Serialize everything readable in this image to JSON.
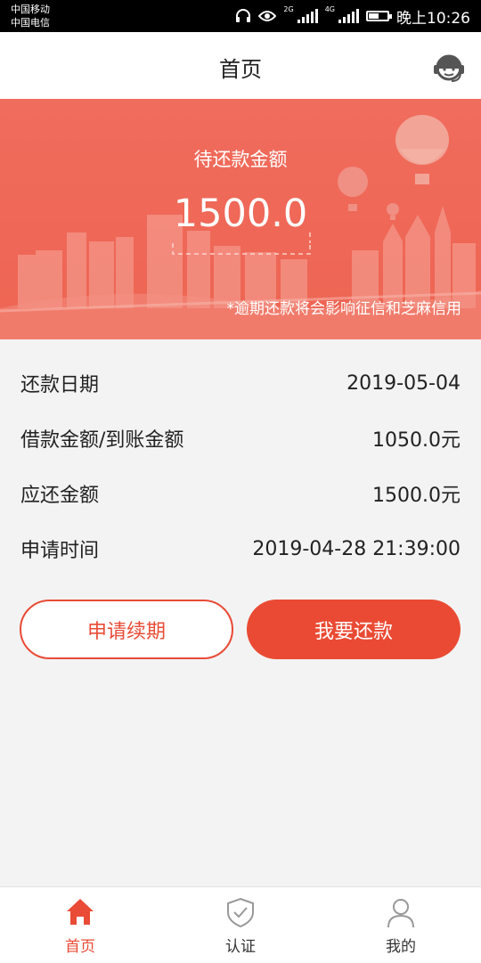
{
  "status_bar": {
    "carrier_1": "中国移动",
    "carrier_2": "中国电信",
    "network_1": "2G",
    "network_2": "4G",
    "time": "晚上10:26",
    "battery_level": 0.55
  },
  "header": {
    "title": "首页",
    "support_icon": "customer-service-icon"
  },
  "banner": {
    "title": "待还款金额",
    "amount": "1500.0",
    "note": "*逾期还款将会影响征信和芝麻信用"
  },
  "details": [
    {
      "label": "还款日期",
      "value": "2019-05-04"
    },
    {
      "label": "借款金额/到账金额",
      "value": "1050.0元"
    },
    {
      "label": "应还金额",
      "value": "1500.0元"
    },
    {
      "label": "申请时间",
      "value": "2019-04-28 21:39:00"
    }
  ],
  "actions": {
    "renew_label": "申请续期",
    "repay_label": "我要还款"
  },
  "bottom_nav": [
    {
      "label": "首页",
      "icon": "home-icon",
      "active": true
    },
    {
      "label": "认证",
      "icon": "shield-check-icon",
      "active": false
    },
    {
      "label": "我的",
      "icon": "user-icon",
      "active": false
    }
  ],
  "colors": {
    "accent": "#e94b36",
    "banner": "#ee6553"
  }
}
